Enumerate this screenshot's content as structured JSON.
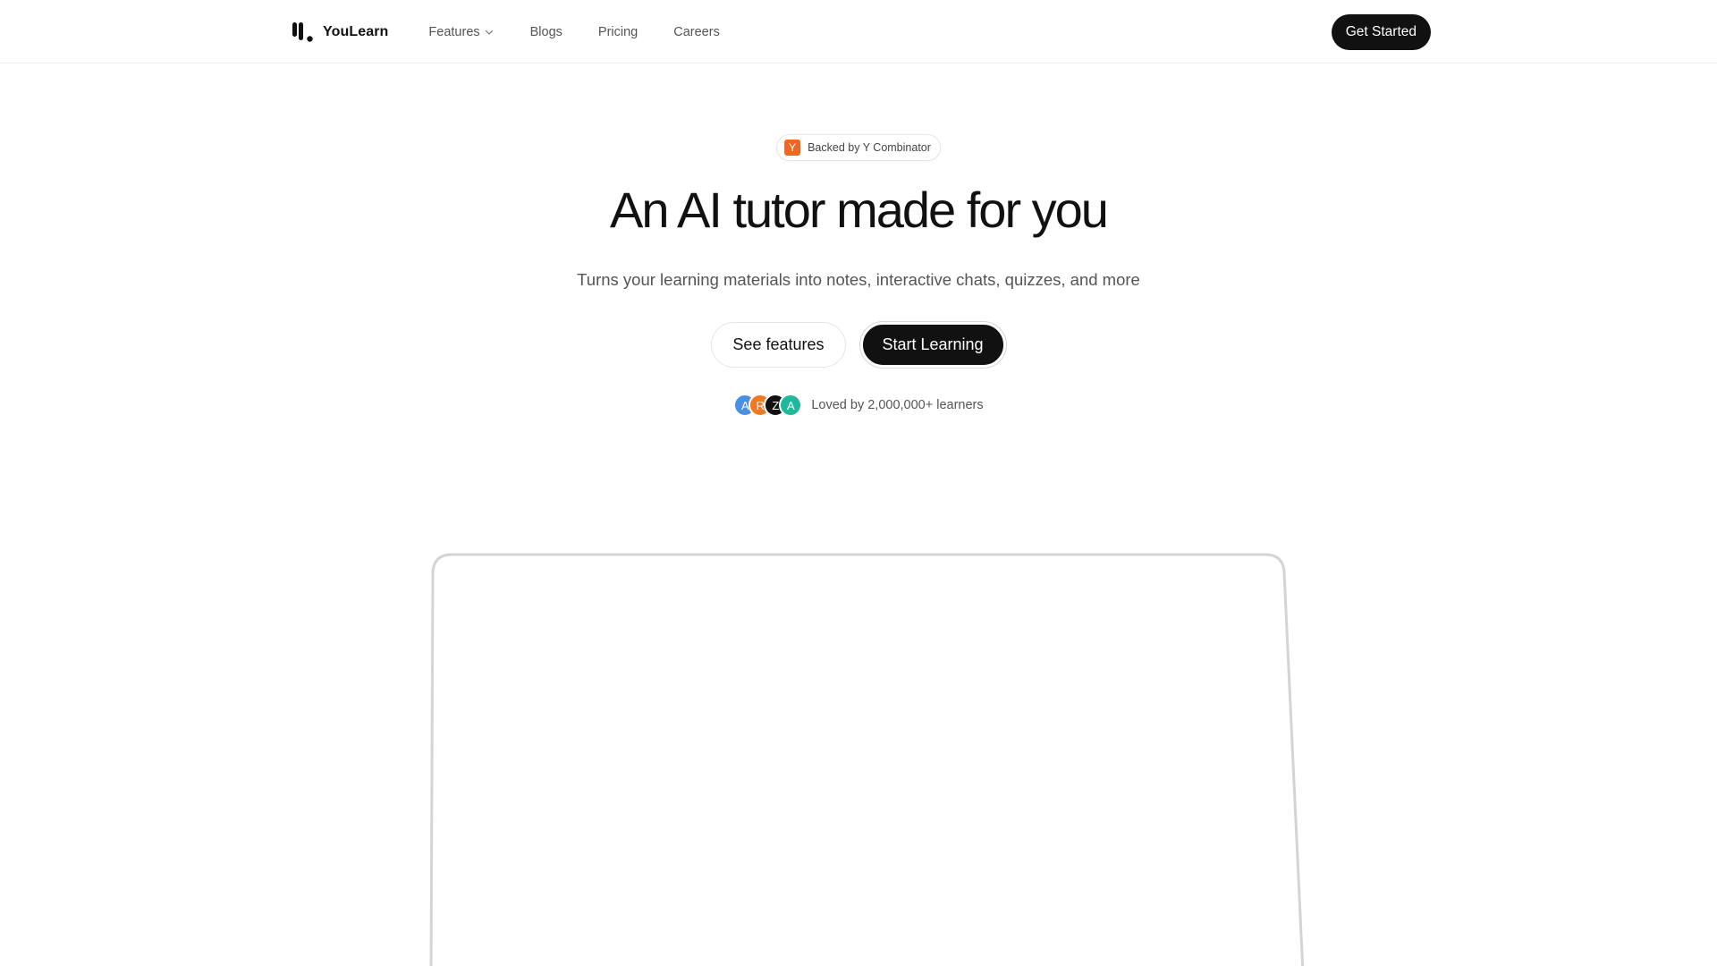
{
  "brand": {
    "name": "YouLearn",
    "logo_icon": "youlearn-logo-icon"
  },
  "nav": {
    "links": [
      {
        "label": "Features",
        "has_dropdown": true
      },
      {
        "label": "Blogs"
      },
      {
        "label": "Pricing"
      },
      {
        "label": "Careers"
      }
    ],
    "cta_label": "Get Started"
  },
  "badge": {
    "icon_letter": "Y",
    "text": "Backed by Y Combinator",
    "icon_color": "#f26522"
  },
  "hero": {
    "title": "An AI tutor made for you",
    "subtitle": "Turns your learning materials into notes, interactive chats, quizzes, and more",
    "secondary_cta": "See features",
    "primary_cta": "Start Learning"
  },
  "social_proof": {
    "avatars": [
      {
        "letter": "A",
        "color": "#4a8fe0"
      },
      {
        "letter": "R",
        "color": "#f07a22"
      },
      {
        "letter": "Z",
        "color": "#111111"
      },
      {
        "letter": "A",
        "color": "#1fb89a"
      }
    ],
    "text": "Loved by 2,000,000+ learners"
  },
  "colors": {
    "accent_dark": "#111111",
    "frame_border": "#d6d6d6"
  }
}
